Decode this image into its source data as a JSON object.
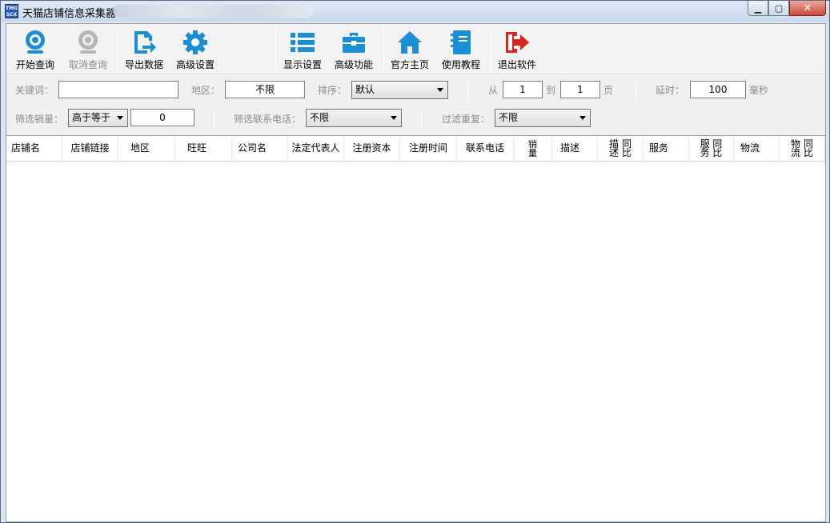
{
  "window": {
    "title": "天猫店铺信息采集器",
    "app_icon_text": "TMG SCX",
    "controls": [
      "minimize",
      "maximize",
      "close"
    ]
  },
  "toolbar": {
    "start_query": "开始查询",
    "cancel_query": "取消查询",
    "export_data": "导出数据",
    "advanced_settings": "高级设置",
    "display_settings": "显示设置",
    "advanced_functions": "高级功能",
    "official_home": "官方主页",
    "tutorial": "使用教程",
    "exit": "退出软件"
  },
  "filters": {
    "keyword_label": "关键词：",
    "keyword_value": "",
    "region_label": "地区：",
    "region_value": "不限",
    "sort_label": "排序：",
    "sort_value": "默认",
    "page_from_label": "从",
    "page_from_value": "1",
    "page_to_label": "到",
    "page_to_value": "1",
    "page_unit": "页",
    "delay_label": "延时：",
    "delay_value": "100",
    "delay_unit": "毫秒",
    "sales_label": "筛选销量：",
    "sales_op": "高于等于",
    "sales_value": "0",
    "phone_label": "筛选联系电话：",
    "phone_value": "不限",
    "dedupe_label": "过滤重复：",
    "dedupe_value": "不限"
  },
  "table": {
    "columns": [
      "店铺名",
      "店铺链接",
      "地区",
      "旺旺",
      "公司名",
      "法定代表人",
      "注册资本",
      "注册时间",
      "联系电话",
      "销量",
      "描述",
      "描述同比",
      "服务",
      "服务同比",
      "物流",
      "物流同比"
    ],
    "rows": []
  },
  "colors": {
    "accent_blue": "#1b8fd6",
    "exit_red": "#d9261c",
    "disabled_gray": "#9a9a9a"
  }
}
